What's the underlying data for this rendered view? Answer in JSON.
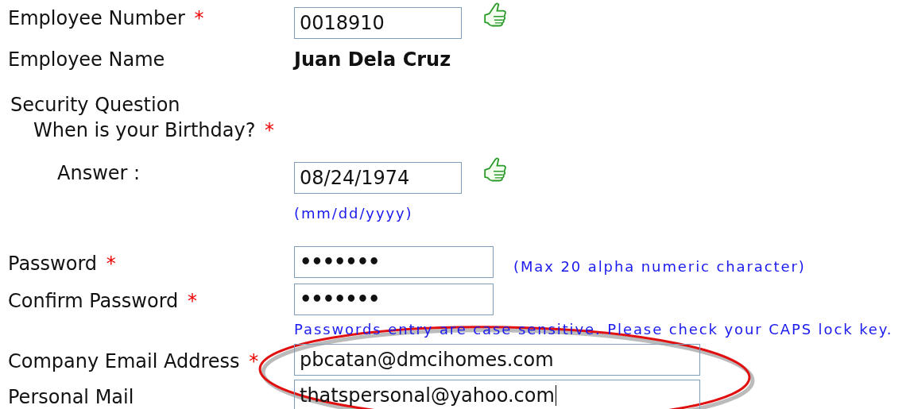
{
  "fields": [
    {
      "kind": "number_input",
      "label": "Employee Number",
      "required_mark": "*",
      "value": "0018910",
      "valid": true
    },
    {
      "kind": "display",
      "label": "Employee Name",
      "value": "Juan Dela Cruz"
    },
    {
      "kind": "section",
      "label": "Security Question"
    },
    {
      "kind": "question",
      "label": "When is your Birthday?",
      "required_mark": "*"
    },
    {
      "kind": "answer_input",
      "label": "Answer :",
      "value": "08/24/1974",
      "valid": true,
      "hint": "(mm/dd/yyyy)"
    },
    {
      "kind": "password_input",
      "label": "Password",
      "required_mark": "*",
      "value": "•••••••",
      "side_hint": "(Max 20 alpha numeric character)"
    },
    {
      "kind": "password_input",
      "label": "Confirm Password",
      "required_mark": "*",
      "value": "•••••••",
      "hint": "Passwords entry are case sensitive. Please check your CAPS lock key."
    },
    {
      "kind": "email_input",
      "label": "Company Email Address",
      "required_mark": "*",
      "value": "pbcatan@dmcihomes.com"
    },
    {
      "kind": "email_input",
      "label": "Personal Mail",
      "value": "thatspersonal@yahoo.com",
      "focused": true
    }
  ],
  "annotation": {
    "kind": "ellipse"
  }
}
